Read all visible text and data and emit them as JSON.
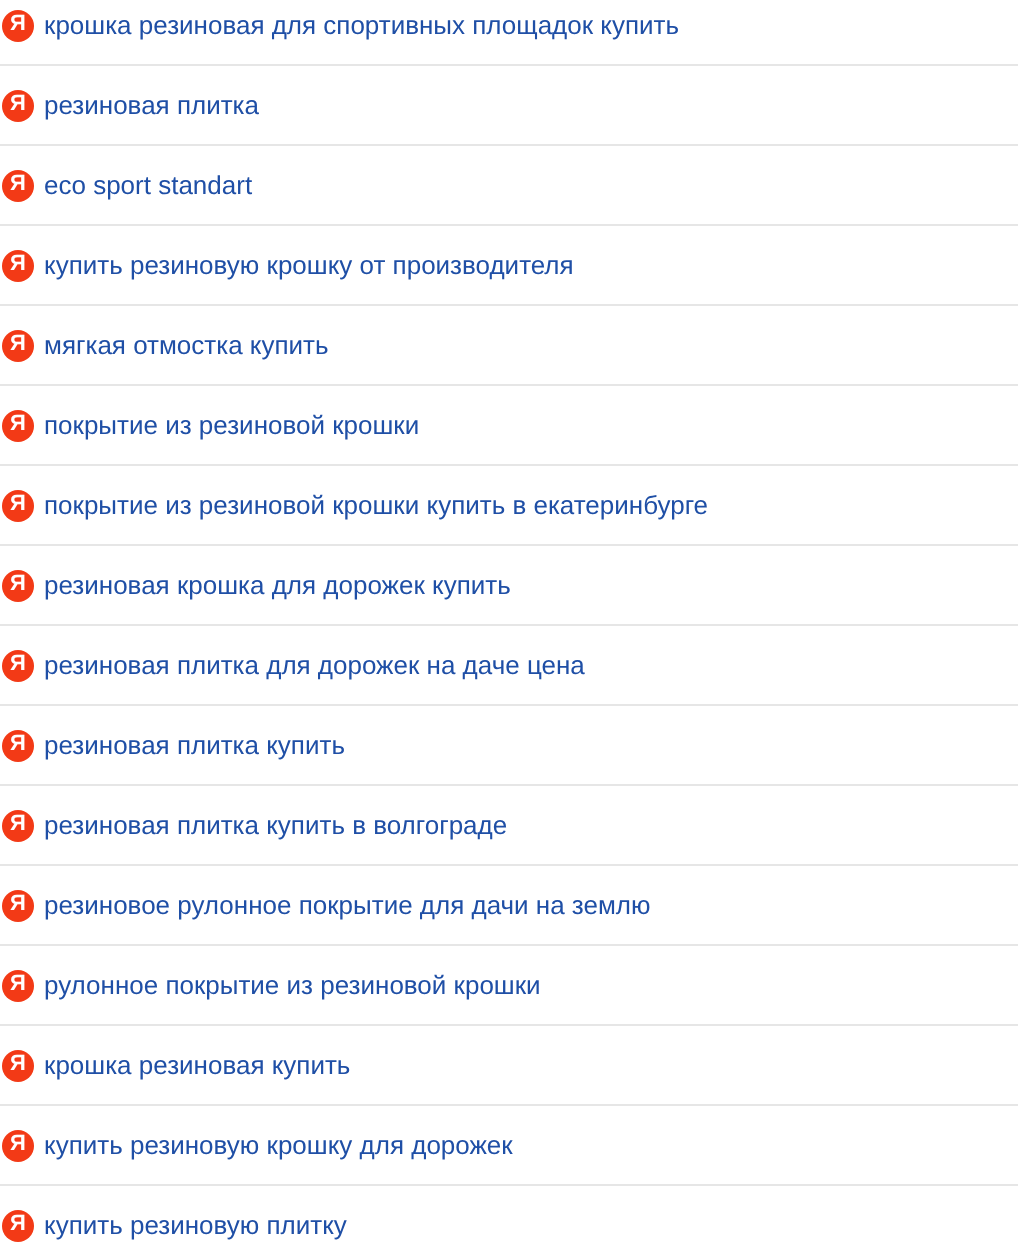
{
  "queries": [
    {
      "icon_letter": "Я",
      "text": "крошка резиновая для спортивных площадок купить"
    },
    {
      "icon_letter": "Я",
      "text": "резиновая плитка"
    },
    {
      "icon_letter": "Я",
      "text": "eco sport standart"
    },
    {
      "icon_letter": "Я",
      "text": "купить резиновую крошку от производителя"
    },
    {
      "icon_letter": "Я",
      "text": "мягкая отмостка купить"
    },
    {
      "icon_letter": "Я",
      "text": "покрытие из резиновой крошки"
    },
    {
      "icon_letter": "Я",
      "text": "покрытие из резиновой крошки купить в екатеринбурге"
    },
    {
      "icon_letter": "Я",
      "text": "резиновая крошка для дорожек купить"
    },
    {
      "icon_letter": "Я",
      "text": "резиновая плитка для дорожек на даче цена"
    },
    {
      "icon_letter": "Я",
      "text": "резиновая плитка купить"
    },
    {
      "icon_letter": "Я",
      "text": "резиновая плитка купить в волгограде"
    },
    {
      "icon_letter": "Я",
      "text": "резиновое рулонное покрытие для дачи на землю"
    },
    {
      "icon_letter": "Я",
      "text": "рулонное покрытие из резиновой крошки"
    },
    {
      "icon_letter": "Я",
      "text": "крошка резиновая купить"
    },
    {
      "icon_letter": "Я",
      "text": "купить резиновую крошку для дорожек"
    },
    {
      "icon_letter": "Я",
      "text": "купить резиновую плитку"
    }
  ]
}
